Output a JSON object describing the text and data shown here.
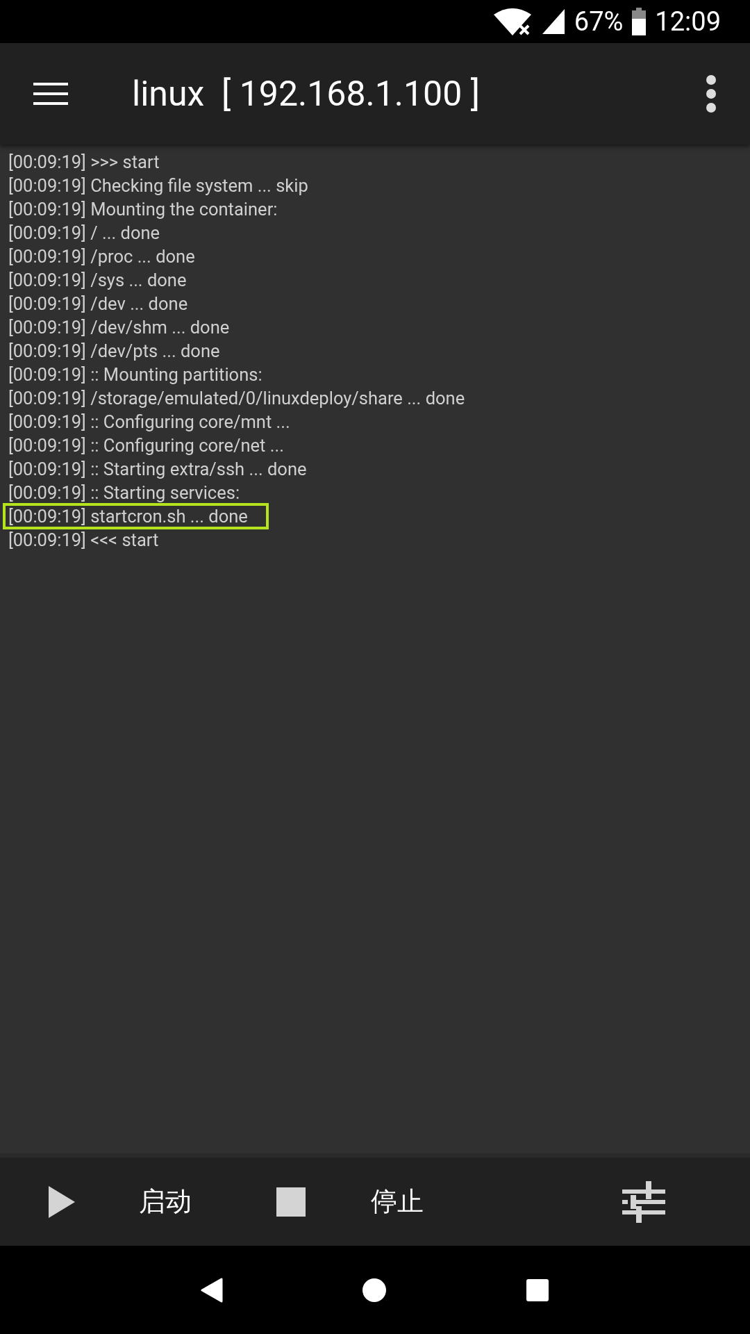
{
  "status_bar": {
    "battery": "67%",
    "time": "12:09"
  },
  "app_bar": {
    "title": "linux  [ 192.168.1.100 ]"
  },
  "log": [
    {
      "text": "[00:09:19] >>> start",
      "highlighted": false
    },
    {
      "text": "[00:09:19] Checking file system ... skip",
      "highlighted": false
    },
    {
      "text": "[00:09:19] Mounting the container:",
      "highlighted": false
    },
    {
      "text": "[00:09:19] / ... done",
      "highlighted": false
    },
    {
      "text": "[00:09:19] /proc ... done",
      "highlighted": false
    },
    {
      "text": "[00:09:19] /sys ... done",
      "highlighted": false
    },
    {
      "text": "[00:09:19] /dev ... done",
      "highlighted": false
    },
    {
      "text": "[00:09:19] /dev/shm ... done",
      "highlighted": false
    },
    {
      "text": "[00:09:19] /dev/pts ... done",
      "highlighted": false
    },
    {
      "text": "[00:09:19] :: Mounting partitions:",
      "highlighted": false
    },
    {
      "text": "[00:09:19] /storage/emulated/0/linuxdeploy/share ... done",
      "highlighted": false
    },
    {
      "text": "[00:09:19] :: Configuring core/mnt ...",
      "highlighted": false
    },
    {
      "text": "[00:09:19] :: Configuring core/net ...",
      "highlighted": false
    },
    {
      "text": "[00:09:19] :: Starting extra/ssh ... done",
      "highlighted": false
    },
    {
      "text": "[00:09:19] :: Starting services:",
      "highlighted": false
    },
    {
      "text": "[00:09:19] startcron.sh ... done",
      "highlighted": true
    },
    {
      "text": "[00:09:19] <<< start",
      "highlighted": false
    }
  ],
  "bottom_bar": {
    "buttons": [
      {
        "kind": "start",
        "label": "启动"
      },
      {
        "kind": "stop",
        "label": "停止"
      },
      {
        "kind": "properties"
      }
    ]
  }
}
